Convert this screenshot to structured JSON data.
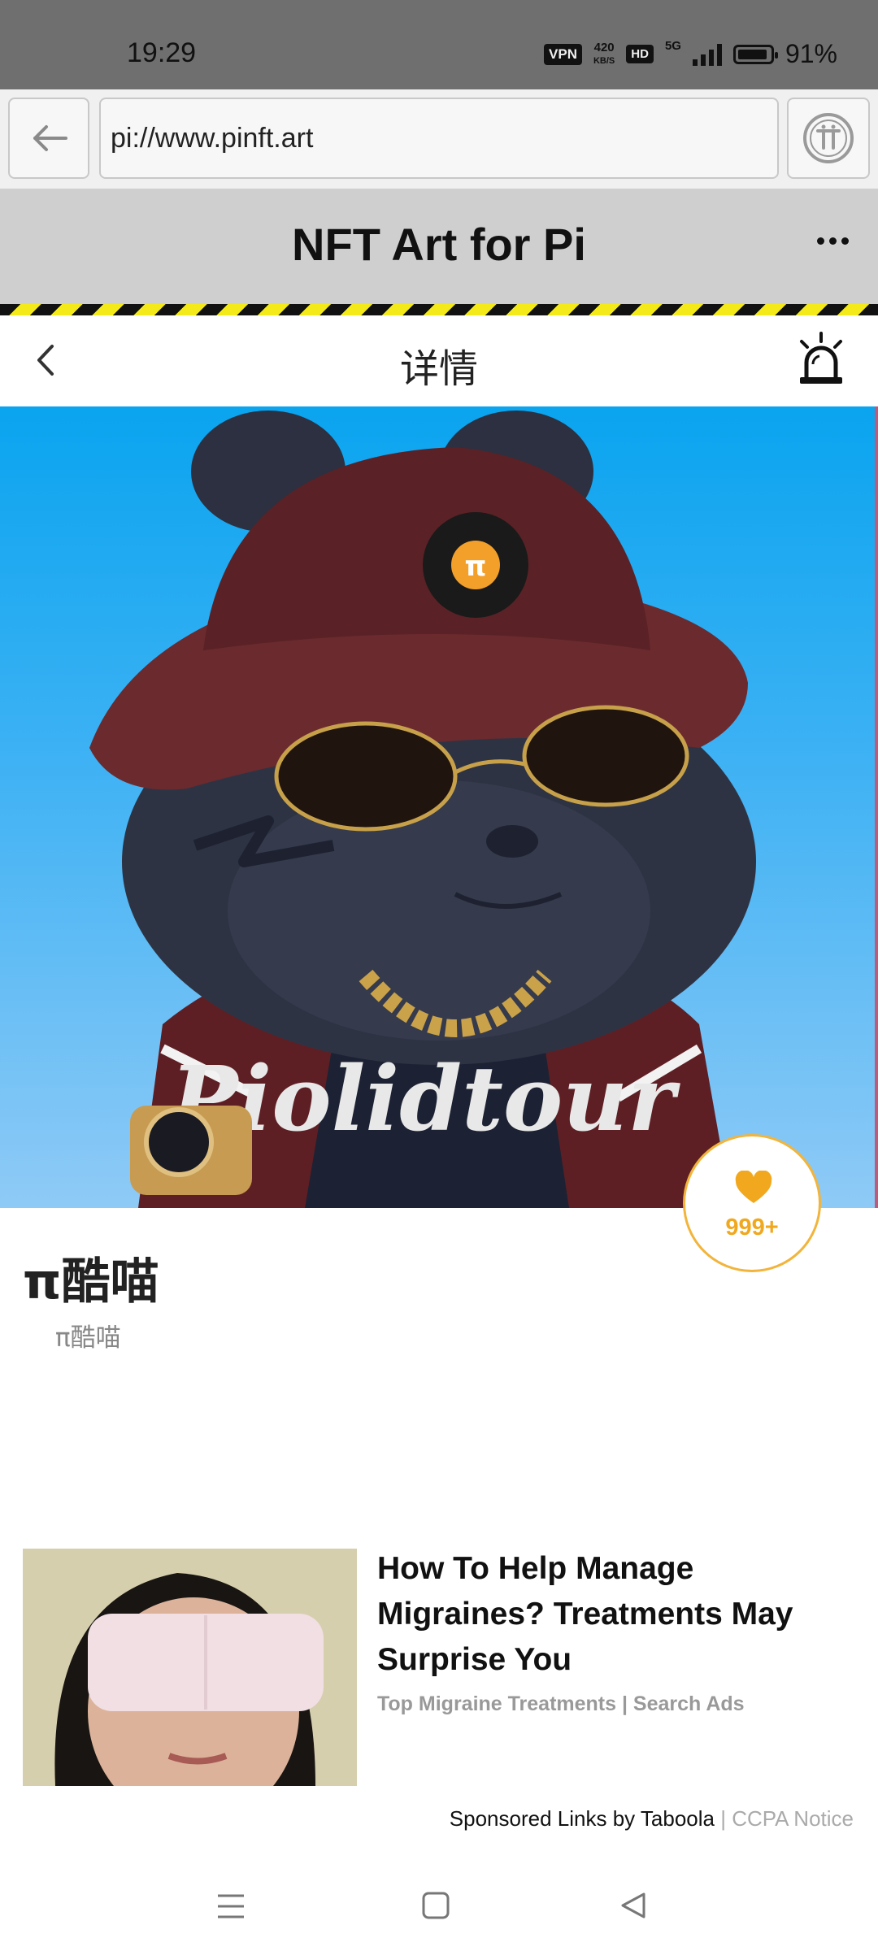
{
  "status_bar": {
    "time": "19:29",
    "vpn_label": "VPN",
    "speed_value": "420",
    "speed_unit": "KB/S",
    "hd_label": "HD",
    "network_label": "5G",
    "battery_percent": "91%",
    "battery_level": 0.91
  },
  "browser": {
    "url": "pi://www.pinft.art",
    "back_icon": "back-arrow-icon",
    "pi_icon": "pi-browser-icon"
  },
  "app": {
    "title": "NFT Art for Pi",
    "more_icon": "more-dots-icon"
  },
  "detail": {
    "title": "详情",
    "back_icon": "chevron-left-icon",
    "report_icon": "alarm-siren-icon"
  },
  "nft": {
    "name": "π酷喵",
    "subname": "π酷喵",
    "like_count": "999+",
    "accent": "#f0a81f"
  },
  "ad": {
    "title": "How To Help Manage Migraines? Treatments May Surprise You",
    "source": "Top Migraine Treatments | Search Ads",
    "sponsored_text": "Sponsored Links by Taboola",
    "ccpa_text": " | CCPA Notice"
  },
  "nav": {
    "menu_icon": "menu-icon",
    "home_icon": "home-square-icon",
    "back_icon": "triangle-back-icon"
  }
}
